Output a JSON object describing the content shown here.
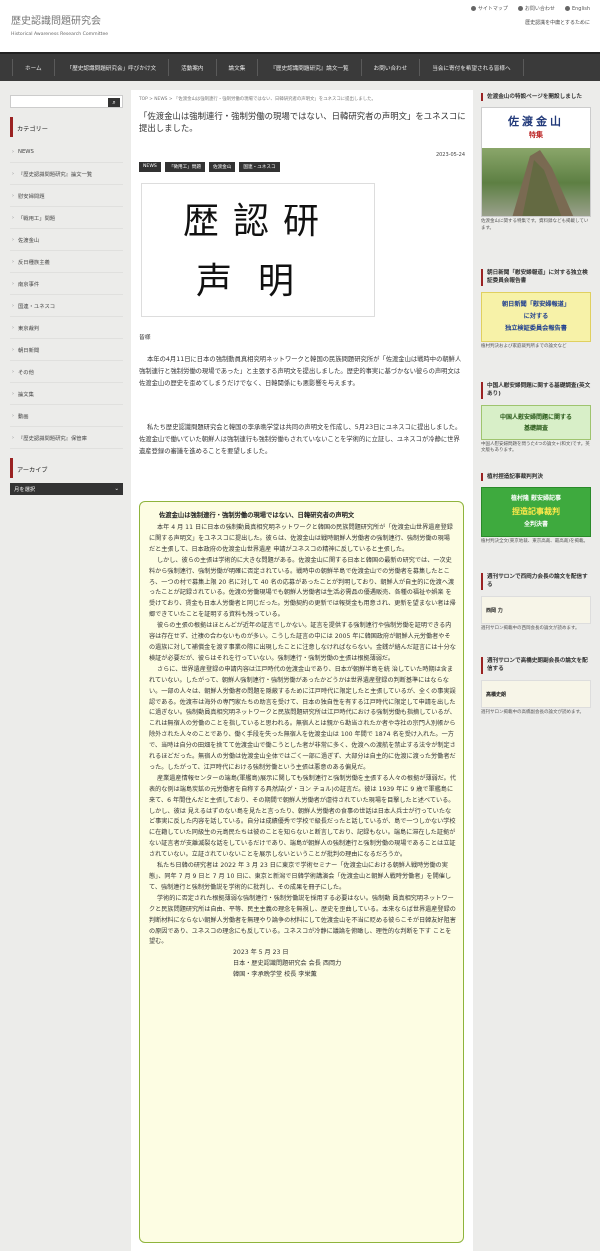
{
  "header": {
    "site_title": "歴史認識問題研究会",
    "site_sub": "Historical Awareness Research Committee",
    "links": [
      "サイトマップ",
      "お問い合わせ",
      "English"
    ],
    "tagline": "歴史認識を中庸とするために"
  },
  "nav": [
    "ホーム",
    "「歴史認識問題研究会」呼びかけ文",
    "活動案内",
    "論文集",
    "『歴史認識問題研究』論文一覧",
    "お問い合わせ",
    "当会に寄付を希望される皆様へ"
  ],
  "left": {
    "category_head": "カテゴリー",
    "categories": [
      "NEWS",
      "『歴史認識問題研究』論文一覧",
      "慰安婦問題",
      "「戦用工」問題",
      "佐渡金山",
      "反日種族主義",
      "南京事件",
      "国連・ユネスコ",
      "東京裁判",
      "朝日新聞",
      "その他",
      "論文集",
      "動画",
      "『歴史認識問題研究』保管庫"
    ],
    "archive_head": "アーカイブ",
    "archive_select": "月を選択"
  },
  "main": {
    "breadcrumb": "TOP > NEWS > 「佐渡金山は強制連行・強制労働の現場ではない、日韓研究者の声明文」をユネスコに提出しました。",
    "title": "「佐渡金山は強制連行・強制労働の現場ではない、日韓研究者の声明文」をユネスコに提出しました。",
    "date": "2023-05-24",
    "tags": [
      "NEWS",
      "「徴用工」問題",
      "佐渡金山",
      "国連・ユネスコ"
    ],
    "logo_line1": "歴認研",
    "logo_line2": "声明",
    "greeting": "皆様",
    "p1": "本年の4月11日に日本の強制動員真相究明ネットワークと韓国の民族問題研究所が「佐渡金山は戦時中の朝鮮人強制連行と強制労働の現場であった」と主張する声明文を提出しました。歴史的事実に基づかない彼らの声明文は佐渡金山の歴史を歪めてしまうだけでなく、日韓関係にも悪影響を与えます。",
    "p2": "私たち歴史認識問題研究会と韓国の李承晩学堂は共同の声明文を作成し、5月23日にユネスコに提出しました。佐渡金山で働いていた朝鮮人は強制連行も強制労働もされていないことを学術的に立証し、ユネスコが冷静に世界遺産登録の審議を進めることを要望しました。",
    "statement": {
      "title": "佐渡金山は強制連行・強制労働の現場ではない、日韓研究者の声明文",
      "paras": [
        "本年 4 月 11 日に日本の強制動員真相究明ネットワークと韓国の民族問題研究所が「佐渡金山世界遺産登録に関する声明文」をユネスコに提出した。彼らは、佐渡金山は戦時朝鮮人労働者の強制連行、強制労働の現場だと主張して、日本政府の佐渡金山世界遺産 申請がユネスコの精神に反していると主張した。",
        "しかし、彼らの主張は学術的に大きな問題がある。佐渡金山に関する日本と韓国の最新の研究では、一次史料から強制連行、強制労働が明確に否定されている。戦時中の朝鮮半島で佐渡金山での労働者を募集したところ、一つの村で募集上限 20 名に対して 40 名の応募があったことが判明しており、朝鮮人が自主的に佐渡へ渡ったことが記録されている。佐渡の労働現場でも朝鮮人労働者は生活必需品の優遇販売、各種の福祉や娯楽 を受けており、賃金も日本人労働者と同じだった。労働契約の更新では報奨金も用意され、更新を望まない者は帰郷できていたことを証明する資料も残っている。",
        "彼らの主張の根拠はほとんどが近年の証言でしかない。証言を提供する強制連行や強制労働を証明できる内容は存在せず、辻褄の合わないものが多い。こうした証言の中には 2005 年に韓国政府が朝鮮人元労働者やその遺族に対して補償金を渡す事業の際に出現したことに注意しなければならない。金銭が絡んだ証言には十分な検証が必要だが、彼らはそれを行っていない。強制連行・強制労働の主張は根拠薄弱だ。",
        "さらに、世界遺産登録の申請内容は江戸時代の佐渡金山であり、日本が朝鮮半島を統 治していた時期は含まれていない。したがって、朝鮮人強制連行・強制労働があったかどうかは世界遺産登録の判断基準にはならない。一部の人々は、朝鮮人労働者の問題を隠蔽するために江戸時代に限定したと主張しているが、全くの事実誤認である。佐渡市は海外の専門家たちの助言を受けて、日本の独自性を有する江戸時代に限定して申請を出したに過ぎない。強制動員真相究明ネットワークと民族問題研究所は江戸時代における強制労働も指摘しているが、これは無宿人の労働のことを指していると思われる。無宿人とは親から勘当されたか者や寺社の宗門人別帳から除外された人々のことであり、働く手段を失った無宿人を佐渡金山は 100 年間で 1874 名を受け入れた。一方で、当時は自分の田畑を捨てて佐渡金山で働こうとした者が非常に多く、佐渡への渡航を禁止する法令が制定されるほどだった。無宿人の労働は佐渡金山全体ではごく一部に過ぎず、大部分は自主的に佐渡に渡った労働者だった。したがって、江戸時代における強制労働という主張は悪意のある偏見だ。",
        "産業遺産情報センターの端島(軍艦島)展示に関しても強制連行と強制労働を主張する人々の根拠が薄弱だ。代表的な例は端島炭鉱の元労働者を自称する具然詰(グ・ヨン チョル)の証言だ。彼は 1939 年に 9 歳で軍艦島に来て、6 年間住んだと主張しており、その期間で朝鮮人労働者が虐待されていた現場を目撃したと述べている。しかし、彼は 見えるはずのない島を見たと言ったり、朝鮮人労働者の食事の世話は日本人兵士が行っていたなど事実に反した内容を話している。自分は成績優秀で学校で級長だったと話しているが、島で一つしかない学校に在籍していた同級生の元島民たちは彼のことを知らないと断言しており、記録もない。端島に滞在した証拠がない証言者が支離滅裂な話をしているだけであり、端島が朝鮮人の強制連行と強制労働の現場であることは立証されていない。立証されていないことを展示しないということが批判の理由になるだろうか。",
        "私たち日韓の研究者は 2022 年 3 月 23 日に東京で学術セミナー「佐渡金山における朝鮮人戦時労働の実態」、同年 7 月 9 日と 7 月 10 日に、東京と新潟で日韓学術講演会「佐渡金山と朝鮮人戦時労働者」を開催して、強制連行と強制労働説を学術的に批判し、その成果を冊子にした。",
        "学術的に否定された根拠薄弱な強制連行・強制労働説を採用する必要はない。強制動 員真相究明ネットワークと民族問題研究所は自由、平等、民主主義の理念を無視し、歴史を歪曲している。本来ならば世界遺産登録の判断材料にならない朝鮮人労働者を無理やり論争の材料にして佐渡金山を不当に貶める彼らこそが日韓友好阻害の原因であり、ユネスコの理念にも反している。ユネスコが冷静に議論を俯瞰し、理性的な判断を下す ことを望む。"
      ],
      "sig_date": "2023 年 5 月 23 日",
      "sig1": "日本・歴史認識問題研究会 会長 西岡力",
      "sig2": "韓国・李承晩学堂 校長 李栄薫"
    }
  },
  "right": {
    "s1_head": "佐渡金山の特設ページを開設しました",
    "s1_img_title": "佐渡金山",
    "s1_img_sub": "特集",
    "s1_cap": "佐渡金山に関する特集です。資料録なども掲載しています。",
    "s2_head": "朝日新聞「慰安婦報道」に対する独立検証委員会報告書",
    "s2_img": [
      "朝日新聞「慰安婦報道」",
      "に対する",
      "独立検証委員会報告書"
    ],
    "s2_cap": "植村判決および家庭裁判所までの論文など",
    "s3_head": "中国人慰安婦問題に関する基礎調査(英文あり)",
    "s3_img": [
      "中国人慰安婦問題に関する",
      "基礎調査"
    ],
    "s3_cap": "中国人慰安婦問題を問うた4つの論文+(和文)です。英文版もあります。",
    "s4_head": "植村捏造記事裁判判決",
    "s4_img": [
      "植村隆 慰安婦記事",
      "捏造記事裁判",
      "全判決書"
    ],
    "s4_cap": "植村判決全文(東京地裁、東京高裁、最高裁)を掲載。",
    "s5_head": "週刊サロンで西岡力会長の論文を配信する",
    "s5_img": "西岡 力",
    "s5_cap": "週刊サロン掲載中の西岡会長の論文が読めます。",
    "s6_head": "週刊サロンで高橋史朗副会長の論文を配信する",
    "s6_img": "高橋史朗",
    "s6_cap": "週刊サロン掲載中の高橋副会長の論文が読めます。"
  }
}
